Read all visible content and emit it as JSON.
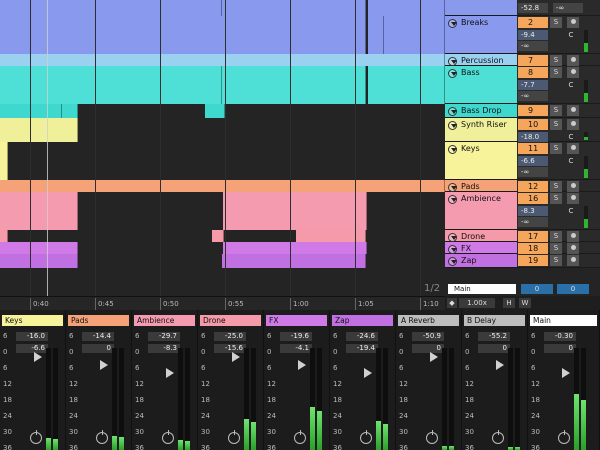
{
  "arrangement": {
    "page_indicator": "1/2",
    "ruler_ticks": [
      "0:40",
      "0:45",
      "0:50",
      "0:55",
      "1:00",
      "1:05",
      "1:10"
    ],
    "tracks": [
      {
        "name": "Breaks",
        "number": "2",
        "color": "#8899ee",
        "volume": "-9.4",
        "pan": "C",
        "sends": "-∞"
      },
      {
        "name": "Percussion",
        "number": "7",
        "color": "#9ad0f0",
        "volume": "",
        "pan": "",
        "sends": ""
      },
      {
        "name": "Bass",
        "number": "8",
        "color": "#4ee0d6",
        "volume": "-7.7",
        "pan": "C",
        "sends": "-∞"
      },
      {
        "name": "Bass Drop",
        "number": "9",
        "color": "#3fd8cf",
        "volume": "",
        "pan": "",
        "sends": ""
      },
      {
        "name": "Synth Riser",
        "number": "10",
        "color": "#f0ef9a",
        "volume": "-18.0",
        "pan": "C",
        "sends": "-∞"
      },
      {
        "name": "Keys",
        "number": "11",
        "color": "#f7f39a",
        "volume": "-6.6",
        "pan": "C",
        "sends": "-∞"
      },
      {
        "name": "Pads",
        "number": "12",
        "color": "#f5a278",
        "volume": "",
        "pan": "",
        "sends": ""
      },
      {
        "name": "Ambience",
        "number": "16",
        "color": "#f49bb0",
        "volume": "-8.3",
        "pan": "C",
        "sends": "-∞"
      },
      {
        "name": "Drone",
        "number": "17",
        "color": "#f59aa8",
        "volume": "",
        "pan": "",
        "sends": ""
      },
      {
        "name": "FX",
        "number": "18",
        "color": "#d07ae8",
        "volume": "",
        "pan": "",
        "sends": ""
      },
      {
        "name": "Zap",
        "number": "19",
        "color": "#c070e0",
        "volume": "",
        "pan": "",
        "sends": ""
      }
    ],
    "top_values": {
      "top_db": "-52.8",
      "top_inf": "-∞"
    },
    "main": {
      "label": "Main",
      "left": "0",
      "right": "0"
    },
    "tempo": {
      "value": "1.00x",
      "h": "H",
      "w": "W"
    }
  },
  "mixer": {
    "scale": [
      "6",
      "0",
      "6",
      "12",
      "18",
      "24",
      "30",
      "36"
    ],
    "strips": [
      {
        "name": "Keys",
        "color": "#f7f39a",
        "peak": "-16.0",
        "vol": "-6.6",
        "level": 0.12
      },
      {
        "name": "Pads",
        "color": "#f5a278",
        "peak": "-14.4",
        "vol": "0",
        "level": 0.14
      },
      {
        "name": "Ambience",
        "color": "#f49bb0",
        "peak": "-29.7",
        "vol": "-8.3",
        "level": 0.1
      },
      {
        "name": "Drone",
        "color": "#f59aa8",
        "peak": "-25.0",
        "vol": "-15.6",
        "level": 0.3
      },
      {
        "name": "FX",
        "color": "#d07ae8",
        "peak": "-19.6",
        "vol": "-4.1",
        "level": 0.42
      },
      {
        "name": "Zap",
        "color": "#c070e0",
        "peak": "-24.6",
        "vol": "-19.4",
        "level": 0.28
      },
      {
        "name": "A Reverb",
        "color": "#bdbdbd",
        "peak": "-50.9",
        "vol": "0",
        "level": 0.04
      },
      {
        "name": "B Delay",
        "color": "#bdbdbd",
        "peak": "-55.2",
        "vol": "0",
        "level": 0.03
      },
      {
        "name": "Main",
        "color": "#ffffff",
        "peak": "-0.30",
        "vol": "0",
        "level": 0.55
      }
    ]
  }
}
